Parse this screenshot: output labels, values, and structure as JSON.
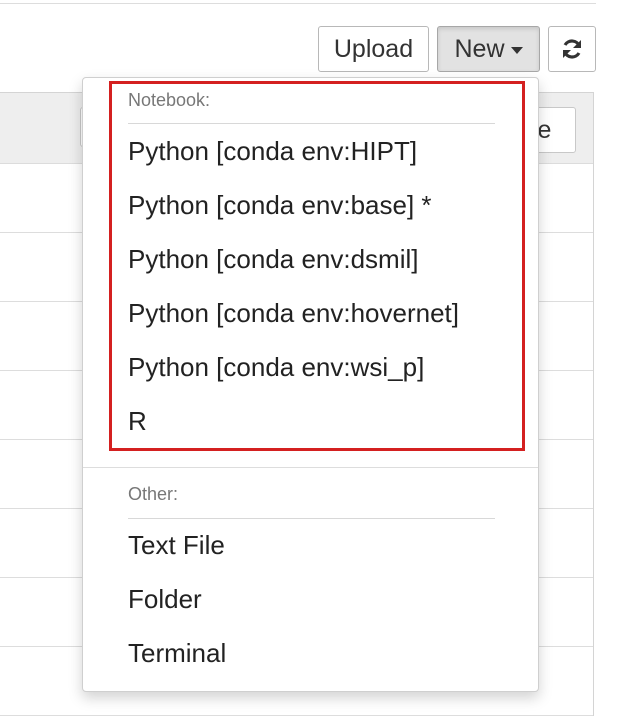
{
  "toolbar": {
    "upload_label": "Upload",
    "new_label": "New",
    "refresh_icon": "refresh-icon"
  },
  "background": {
    "partial_button_text": "ze"
  },
  "dropdown": {
    "notebook_section": {
      "header": "Notebook:",
      "items": [
        "Python [conda env:HIPT]",
        "Python [conda env:base] *",
        "Python [conda env:dsmil]",
        "Python [conda env:hovernet]",
        "Python [conda env:wsi_p]",
        "R"
      ]
    },
    "other_section": {
      "header": "Other:",
      "items": [
        "Text File",
        "Folder",
        "Terminal"
      ]
    },
    "highlight_color": "#d42020"
  }
}
